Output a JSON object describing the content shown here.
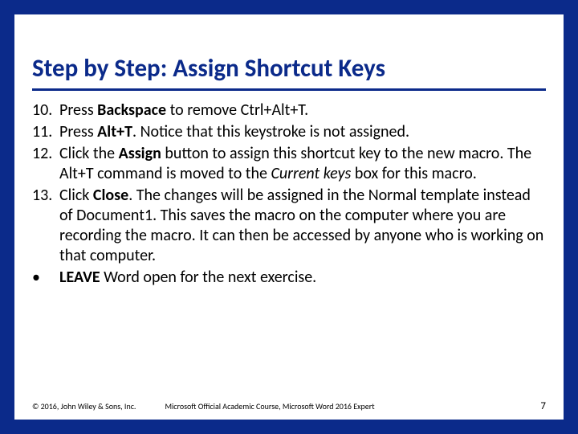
{
  "title": "Step by Step: Assign Shortcut Keys",
  "items": [
    {
      "marker": "10.",
      "segments": [
        {
          "t": "Press "
        },
        {
          "t": "Backspace",
          "bold": true
        },
        {
          "t": " to remove Ctrl+Alt+T."
        }
      ]
    },
    {
      "marker": "11.",
      "segments": [
        {
          "t": "Press "
        },
        {
          "t": "Alt+T",
          "bold": true
        },
        {
          "t": ". Notice that this keystroke is not assigned."
        }
      ]
    },
    {
      "marker": "12.",
      "segments": [
        {
          "t": "Click the "
        },
        {
          "t": "Assign",
          "bold": true
        },
        {
          "t": " button to assign this shortcut key to the new macro. The Alt+T command is moved to the "
        },
        {
          "t": "Current keys",
          "italic": true
        },
        {
          "t": " box for this macro."
        }
      ]
    },
    {
      "marker": "13.",
      "segments": [
        {
          "t": "Click "
        },
        {
          "t": "Close",
          "bold": true
        },
        {
          "t": ". The changes will be assigned in the Normal template instead of Document1. This saves the macro on the computer where you are recording the macro. It can then be accessed by anyone who is working on that computer."
        }
      ]
    },
    {
      "marker": "•",
      "segments": [
        {
          "t": "LEAVE",
          "bold": true
        },
        {
          "t": " Word open for the next exercise."
        }
      ]
    }
  ],
  "footer": {
    "copyright": "© 2016, John Wiley & Sons, Inc.",
    "course": "Microsoft Official Academic Course, Microsoft Word 2016 Expert",
    "page": "7"
  }
}
